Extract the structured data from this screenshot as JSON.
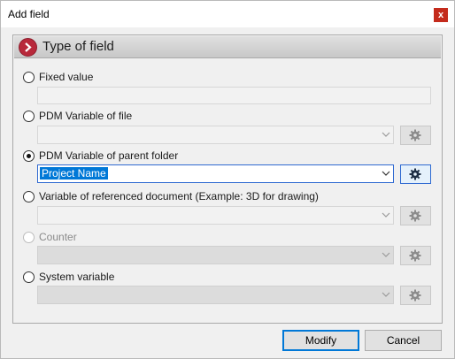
{
  "window": {
    "title": "Add field",
    "close_glyph": "x"
  },
  "panel": {
    "title": "Type of field"
  },
  "options": [
    {
      "label": "Fixed value",
      "checked": false,
      "enabled": true,
      "control": "textbox"
    },
    {
      "label": "PDM Variable of file",
      "checked": false,
      "enabled": true,
      "control": "combo"
    },
    {
      "label": "PDM Variable of parent folder",
      "checked": true,
      "enabled": true,
      "control": "combo",
      "value": "Project Name"
    },
    {
      "label": "Variable of referenced document (Example: 3D for drawing)",
      "checked": false,
      "enabled": true,
      "control": "combo"
    },
    {
      "label": "Counter",
      "checked": false,
      "enabled": false,
      "control": "combo"
    },
    {
      "label": "System variable",
      "checked": false,
      "enabled": true,
      "control": "combo"
    }
  ],
  "buttons": {
    "modify": "Modify",
    "cancel": "Cancel"
  },
  "icons": {
    "header": "chevron-right-icon",
    "settings": "gear-icon",
    "dropdown": "chevron-down-icon"
  },
  "colors": {
    "accent": "#0078d7",
    "header_icon": "#b8293b",
    "close": "#c42b1c"
  }
}
